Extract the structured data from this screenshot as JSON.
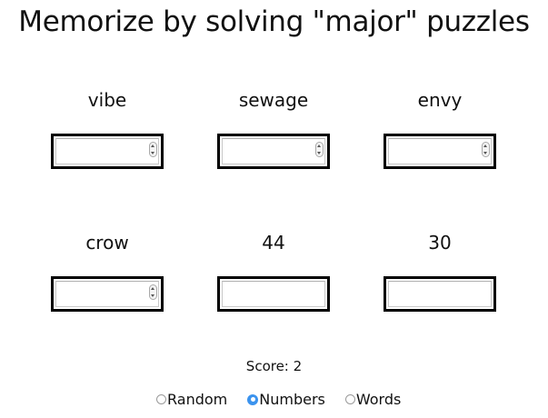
{
  "title": "Memorize by solving \"major\" puzzles",
  "puzzles": [
    {
      "label": "vibe",
      "value": ""
    },
    {
      "label": "sewage",
      "value": ""
    },
    {
      "label": "envy",
      "value": ""
    },
    {
      "label": "crow",
      "value": ""
    },
    {
      "label": "44",
      "value": ""
    },
    {
      "label": "30",
      "value": ""
    }
  ],
  "score": "Score: 2",
  "modes": [
    {
      "label": "Random",
      "selected": false
    },
    {
      "label": "Numbers",
      "selected": true
    },
    {
      "label": "Words",
      "selected": false
    }
  ]
}
